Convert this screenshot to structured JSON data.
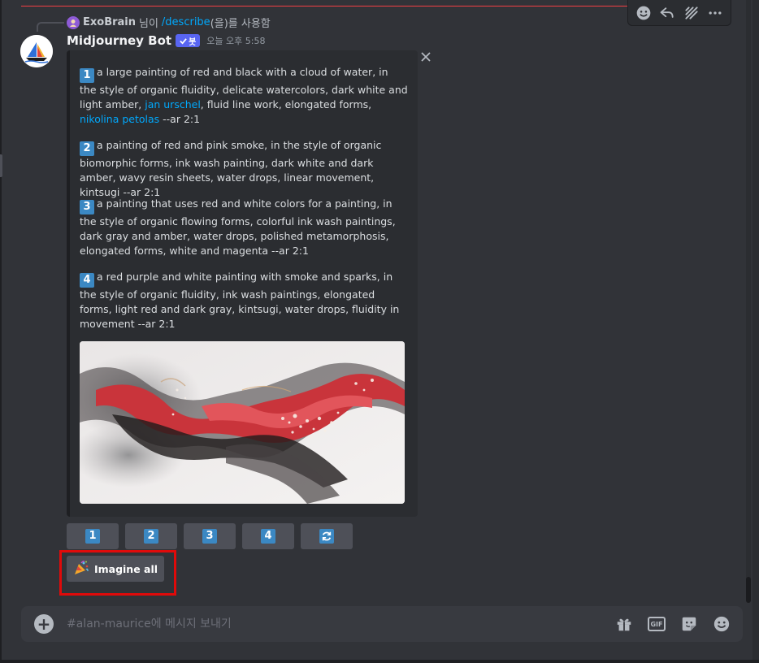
{
  "colors": {
    "background": "#313338",
    "embed": "#2b2d31",
    "link": "#00a8fc",
    "button": "#4e5058",
    "badge_blue": "#3b88c3",
    "bot_tag": "#5865f2",
    "highlight": "#e00a0a"
  },
  "reply": {
    "username": "ExoBrain",
    "suffix": "님이",
    "command": "/describe",
    "tail": "(을)를 사용함"
  },
  "message": {
    "author": "Midjourney Bot",
    "tag": "봇",
    "timestamp": "오늘 오후 5:58"
  },
  "prompts": [
    {
      "num": "1",
      "parts": [
        "a large painting of red and black with a cloud of water, in the style of organic fluidity, delicate watercolors, dark white and light amber, ",
        "jan urschel",
        ", fluid line work, elongated forms, ",
        "nikolina petolas",
        " --ar 2:1"
      ]
    },
    {
      "num": "2",
      "text": "a painting of red and pink smoke, in the style of organic biomorphic forms, ink wash painting, dark white and dark amber, wavy resin sheets, water drops, linear movement, kintsugi --ar 2:1"
    },
    {
      "num": "3",
      "text": "a painting that uses red and white colors for a painting, in the style of organic flowing forms, colorful ink wash paintings, dark gray and amber, water drops, polished metamorphosis, elongated forms, white and magenta --ar 2:1"
    },
    {
      "num": "4",
      "text": "a red purple and white painting with smoke and sparks, in the style of organic fluidity, ink wash paintings, elongated forms, light red and dark gray, kintsugi, water drops, fluidity in movement --ar 2:1"
    }
  ],
  "buttons": {
    "numbers": [
      "1",
      "2",
      "3",
      "4"
    ],
    "refresh_icon": "refresh-icon",
    "imagine_all": "Imagine all",
    "imagine_icon": "party-popper-icon"
  },
  "composer": {
    "placeholder": "#alan-maurice에 메시지 보내기"
  },
  "icons": [
    "emoji-icon",
    "reply-icon",
    "thread-icon",
    "more-icon",
    "close-icon",
    "plus-icon",
    "gift-icon",
    "gif-icon",
    "sticker-icon",
    "emoji-icon"
  ]
}
